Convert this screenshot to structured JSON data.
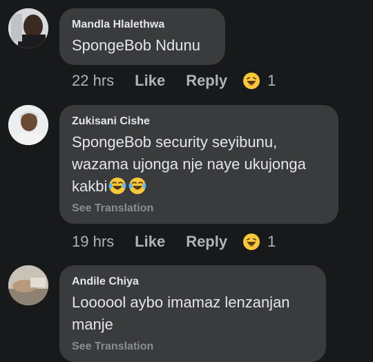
{
  "comments": [
    {
      "author": "Mandla Hlalethwa",
      "text": "SpongeBob Ndunu",
      "see_translation": "",
      "time": "22 hrs",
      "like": "Like",
      "reply": "Reply",
      "reaction_icon": "laughing-face-icon",
      "reaction_count": "1"
    },
    {
      "author": "Zukisani Cishe",
      "text_line1": "SpongeBob security seyibunu,",
      "text_line2": "wazama ujonga nje naye ukujonga",
      "text_line3": "kakbi",
      "text_emojis": [
        "tears-of-joy-icon",
        "tears-of-joy-icon"
      ],
      "see_translation": "See Translation",
      "time": "19 hrs",
      "like": "Like",
      "reply": "Reply",
      "reaction_icon": "laughing-face-icon",
      "reaction_count": "1"
    },
    {
      "author": "Andile Chiya",
      "text_line1": "Loooool aybo imamaz lenzanjan",
      "text_line2": "manje",
      "see_translation": "See Translation"
    }
  ],
  "colors": {
    "background": "#18191a",
    "bubble": "#3a3b3c",
    "primary_text": "#e4e6eb",
    "secondary_text": "#b0b3b8",
    "emoji_yellow": "#f7c83b"
  }
}
